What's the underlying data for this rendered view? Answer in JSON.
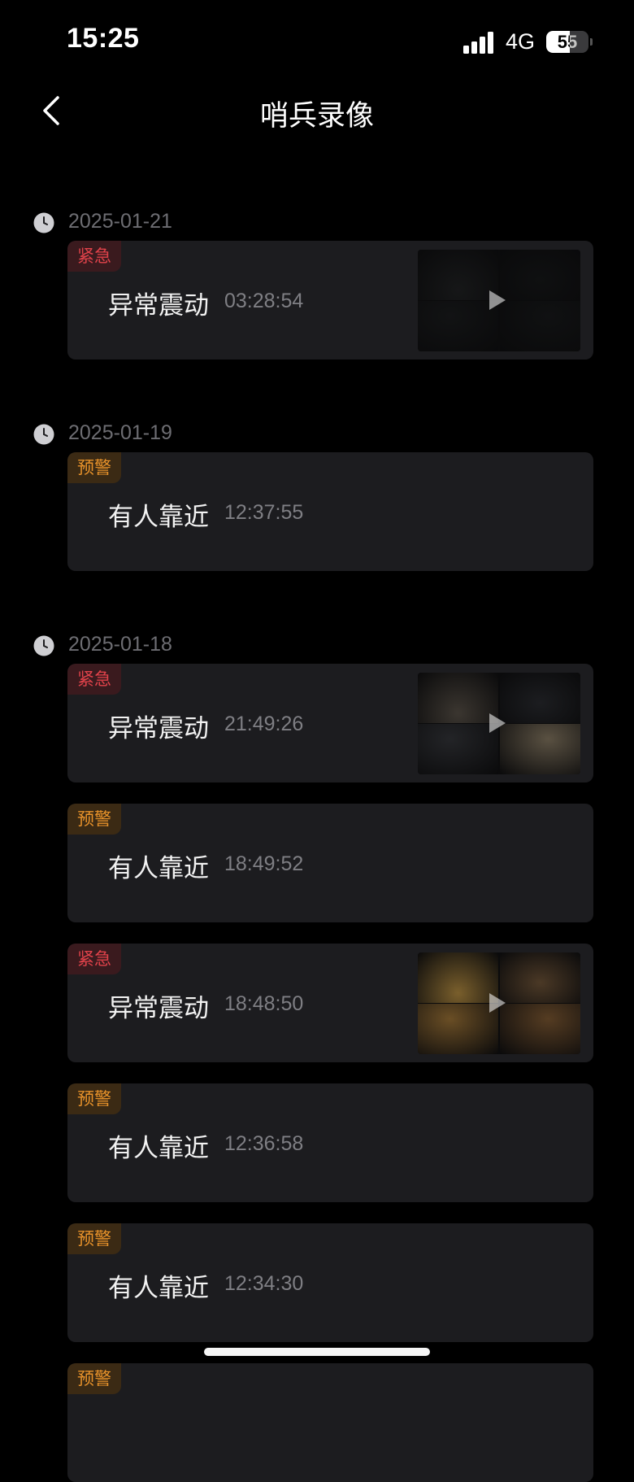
{
  "status_bar": {
    "time": "15:25",
    "network": "4G",
    "battery": "55",
    "battery_level": 0.55
  },
  "nav": {
    "title": "哨兵录像",
    "back_icon": "chevron-left-icon"
  },
  "groups": [
    {
      "date": "2025-01-21",
      "events": [
        {
          "badge": "紧急",
          "level": "urgent",
          "title": "异常震动",
          "time": "03:28:54",
          "has_thumbnail": true,
          "thumb_style": "dark"
        }
      ]
    },
    {
      "date": "2025-01-19",
      "events": [
        {
          "badge": "预警",
          "level": "warning",
          "title": "有人靠近",
          "time": "12:37:55",
          "has_thumbnail": false
        }
      ]
    },
    {
      "date": "2025-01-18",
      "events": [
        {
          "badge": "紧急",
          "level": "urgent",
          "title": "异常震动",
          "time": "21:49:26",
          "has_thumbnail": true,
          "thumb_style": "dim"
        },
        {
          "badge": "预警",
          "level": "warning",
          "title": "有人靠近",
          "time": "18:49:52",
          "has_thumbnail": false
        },
        {
          "badge": "紧急",
          "level": "urgent",
          "title": "异常震动",
          "time": "18:48:50",
          "has_thumbnail": true,
          "thumb_style": "lit"
        },
        {
          "badge": "预警",
          "level": "warning",
          "title": "有人靠近",
          "time": "12:36:58",
          "has_thumbnail": false
        },
        {
          "badge": "预警",
          "level": "warning",
          "title": "有人靠近",
          "time": "12:34:30",
          "has_thumbnail": false
        },
        {
          "badge": "预警",
          "level": "warning",
          "title": "",
          "time": "",
          "has_thumbnail": false
        }
      ]
    }
  ],
  "colors": {
    "background": "#000000",
    "card": "#1c1c1f",
    "urgent": "#e0424a",
    "warning": "#e8922a",
    "muted_text": "#6d6d72"
  }
}
